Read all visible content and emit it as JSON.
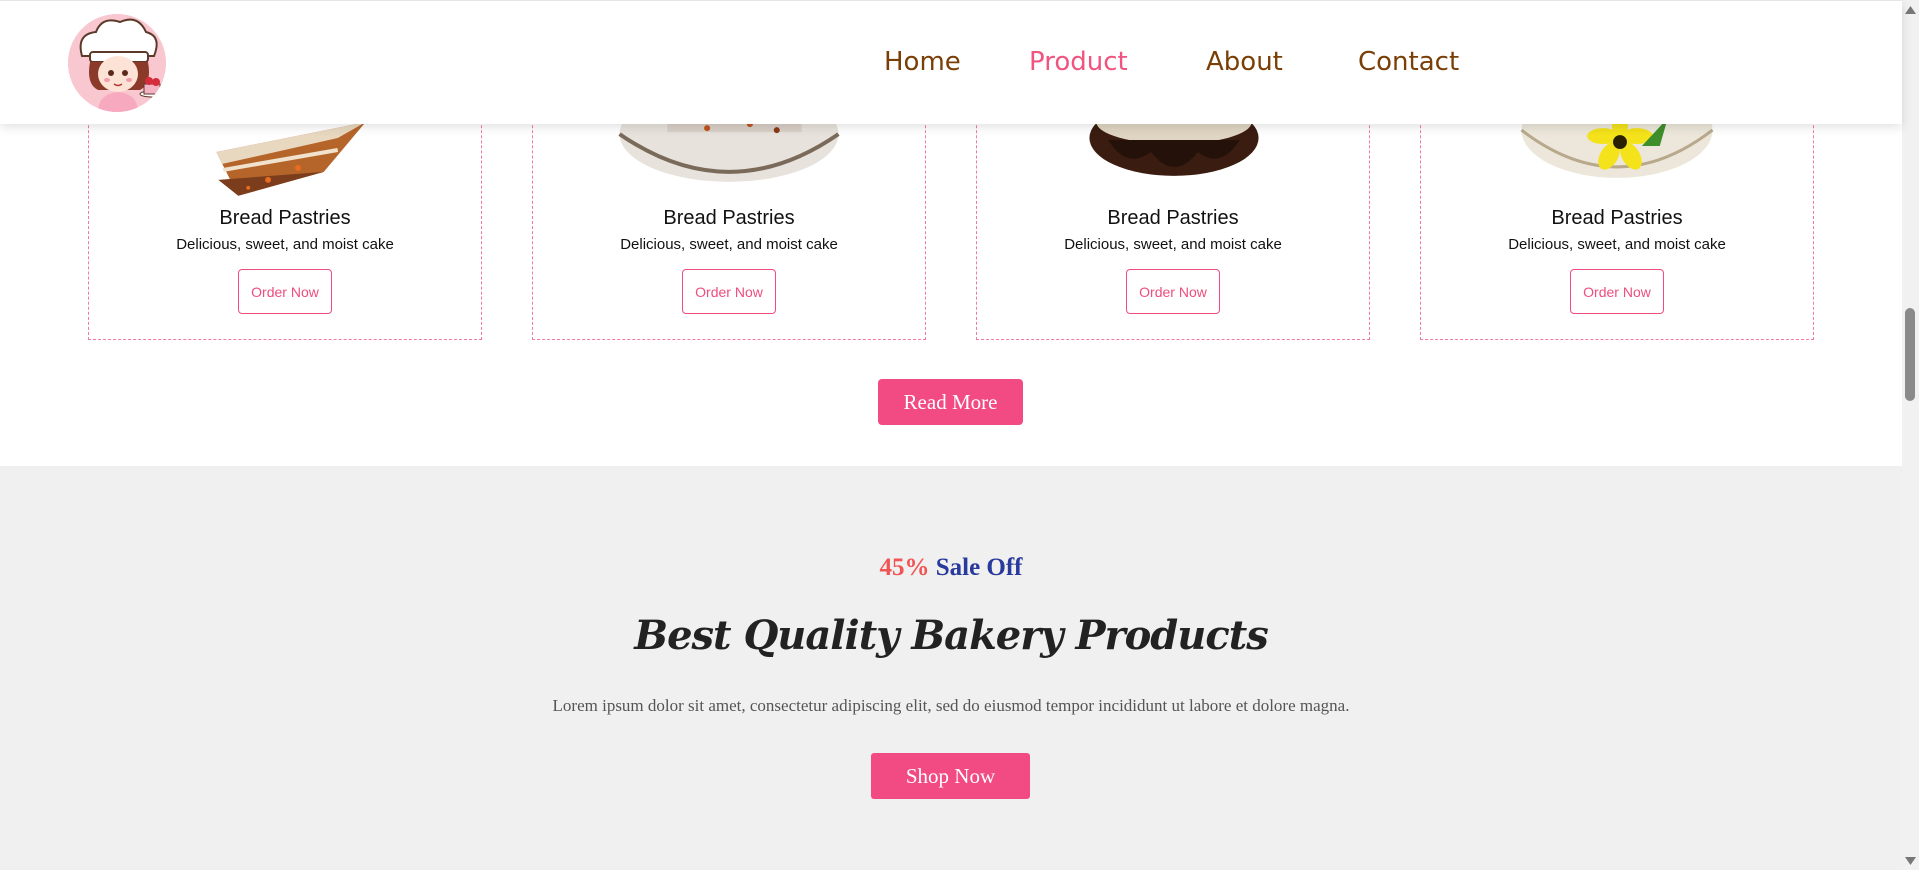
{
  "header": {
    "nav": [
      {
        "label": "Home",
        "active": false
      },
      {
        "label": "Product",
        "active": true
      },
      {
        "label": "About",
        "active": false
      },
      {
        "label": "Contact",
        "active": false
      }
    ]
  },
  "products": [
    {
      "title": "Bread Pastries",
      "description": "Delicious, sweet, and moist cake",
      "button": "Order Now",
      "image": "carrot-cake-slice"
    },
    {
      "title": "Bread Pastries",
      "description": "Delicious, sweet, and moist cake",
      "button": "Order Now",
      "image": "cake-on-plate"
    },
    {
      "title": "Bread Pastries",
      "description": "Delicious, sweet, and moist cake",
      "button": "Order Now",
      "image": "chocolate-cake"
    },
    {
      "title": "Bread Pastries",
      "description": "Delicious, sweet, and moist cake",
      "button": "Order Now",
      "image": "cake-with-flower"
    }
  ],
  "read_more_label": "Read More",
  "sale": {
    "percent": "45%",
    "label": "Sale Off",
    "title": "Best Quality Bakery Products",
    "text": "Lorem ipsum dolor sit amet, consectetur adipiscing elit, sed do eiusmod tempor incididunt ut labore et dolore magna.",
    "button": "Shop Now"
  },
  "colors": {
    "accent": "#f24b84",
    "nav_text": "#7a3f06",
    "nav_active": "#f0557f",
    "sale_percent": "#f05454",
    "sale_label": "#283a9c",
    "section_bg": "#f1f0f0"
  }
}
